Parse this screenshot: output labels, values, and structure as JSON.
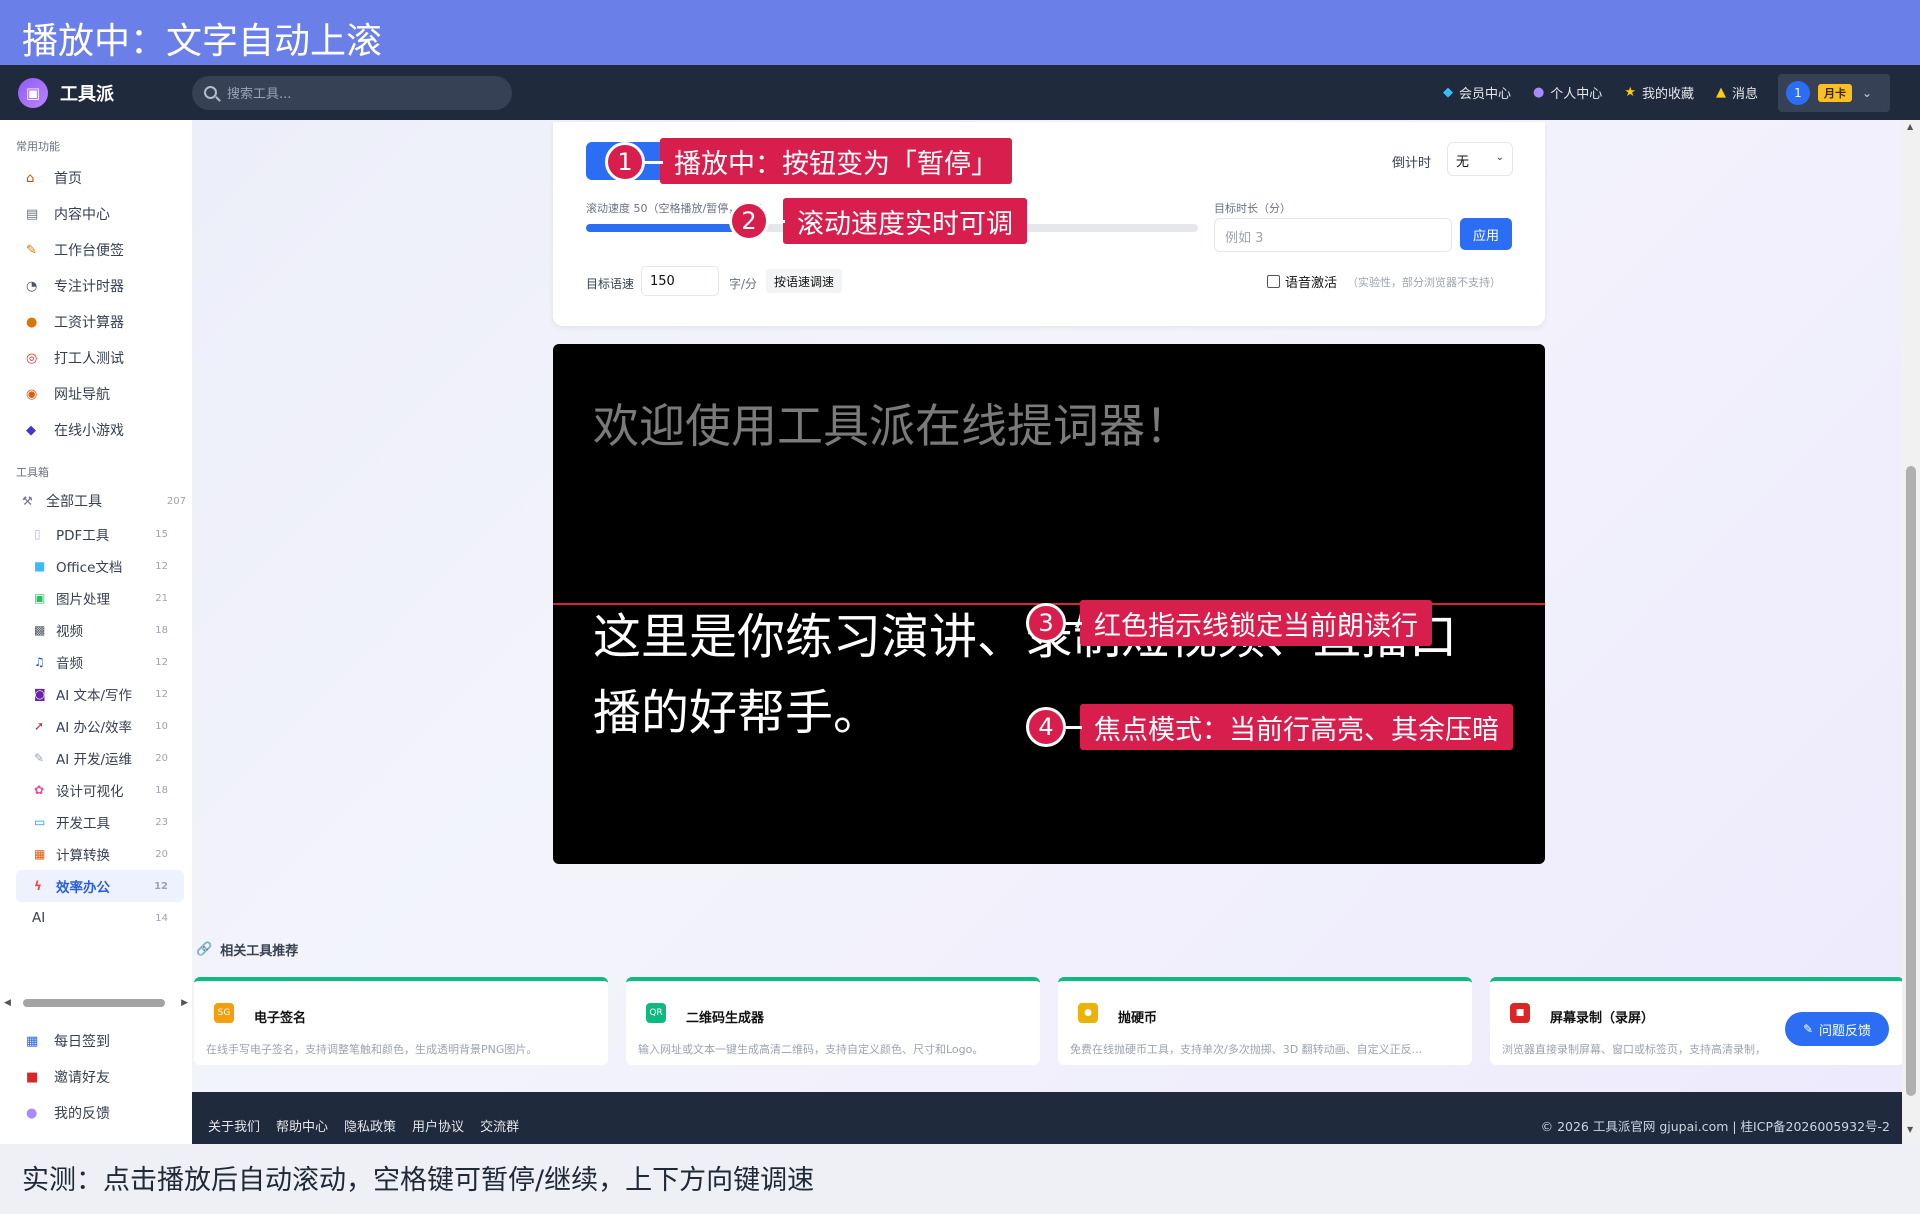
{
  "banner": {
    "title": "播放中：文字自动上滚"
  },
  "header": {
    "logo_text": "工具派",
    "search_placeholder": "搜索工具...",
    "nav": [
      {
        "icon": "diamond-icon",
        "label": "会员中心"
      },
      {
        "icon": "person-icon",
        "label": "个人中心"
      },
      {
        "icon": "star-icon",
        "label": "我的收藏"
      },
      {
        "icon": "bell-icon",
        "label": "消息"
      }
    ],
    "user_avatar": "1",
    "user_badge": "月卡"
  },
  "sidebar": {
    "common_title": "常用功能",
    "common_items": [
      {
        "icon": "home-icon",
        "label": "首页"
      },
      {
        "icon": "news-icon",
        "label": "内容中心"
      },
      {
        "icon": "memo-icon",
        "label": "工作台便签"
      },
      {
        "icon": "stopwatch-icon",
        "label": "专注计时器"
      },
      {
        "icon": "money-bag-icon",
        "label": "工资计算器"
      },
      {
        "icon": "target-icon",
        "label": "打工人测试"
      },
      {
        "icon": "compass-icon",
        "label": "网址导航"
      },
      {
        "icon": "gamepad-icon",
        "label": "在线小游戏"
      }
    ],
    "toolbox_title": "工具箱",
    "all_tools": {
      "label": "全部工具",
      "count": "207"
    },
    "tool_items": [
      {
        "icon": "pdf-icon",
        "label": "PDF工具",
        "count": "15"
      },
      {
        "icon": "office-icon",
        "label": "Office文档",
        "count": "12"
      },
      {
        "icon": "image-icon",
        "label": "图片处理",
        "count": "21"
      },
      {
        "icon": "clapper-icon",
        "label": "视频",
        "count": "18"
      },
      {
        "icon": "music-icon",
        "label": "音频",
        "count": "12"
      },
      {
        "icon": "robot-icon",
        "label": "AI 文本/写作",
        "count": "12"
      },
      {
        "icon": "rocket-icon",
        "label": "AI 办公/效率",
        "count": "10"
      },
      {
        "icon": "wrench-icon",
        "label": "AI 开发/运维",
        "count": "20"
      },
      {
        "icon": "palette-icon",
        "label": "设计可视化",
        "count": "18"
      },
      {
        "icon": "laptop-icon",
        "label": "开发工具",
        "count": "23"
      },
      {
        "icon": "calculator-icon",
        "label": "计算转换",
        "count": "20"
      },
      {
        "icon": "lightning-icon",
        "label": "效率办公",
        "count": "12"
      },
      {
        "icon": "",
        "label": "AI",
        "count": "14"
      }
    ],
    "bottom_items": [
      {
        "icon": "calendar-icon",
        "label": "每日签到"
      },
      {
        "icon": "gift-icon",
        "label": "邀请好友"
      },
      {
        "icon": "speech-icon",
        "label": "我的反馈"
      }
    ]
  },
  "controls": {
    "countdown_label": "倒计时",
    "countdown_value": "无",
    "speed_label": "滚动速度 50（空格播放/暂停，调速",
    "speed_value": 50,
    "speed_fill_fraction": 0.25,
    "duration_label": "目标时长（分）",
    "duration_placeholder": "例如 3",
    "apply_label": "应用",
    "wpm_label": "目标语速",
    "wpm_value": "150",
    "wpm_unit": "字/分",
    "wpm_button": "按语速调速",
    "voice_label": "语音激活",
    "voice_note": "（实验性，部分浏览器不支持）"
  },
  "prompter": {
    "line1": "欢迎使用工具派在线提词器！",
    "line2": "这里是你练习演讲、录制短视频、直播口播的好帮手。"
  },
  "related": {
    "title": "相关工具推荐",
    "cards": [
      {
        "icon_text": "SG",
        "icon_color": "#f59e0b",
        "title": "电子签名",
        "desc": "在线手写电子签名，支持调整笔触和颜色，生成透明背景PNG图片。"
      },
      {
        "icon_text": "QR",
        "icon_color": "#10b981",
        "title": "二维码生成器",
        "desc": "输入网址或文本一键生成高清二维码，支持自定义颜色、尺寸和Logo。"
      },
      {
        "icon_text": "●",
        "icon_color": "#eab308",
        "title": "抛硬币",
        "desc": "免费在线抛硬币工具，支持单次/多次抛掷、3D 翻转动画、自定义正反..."
      },
      {
        "icon_text": "■",
        "icon_color": "#dc2626",
        "title": "屏幕录制（录屏）",
        "desc": "浏览器直接录制屏幕、窗口或标签页，支持高清录制，"
      }
    ]
  },
  "feedback_button": "问题反馈",
  "footer": {
    "links": [
      "关于我们",
      "帮助中心",
      "隐私政策",
      "用户协议",
      "交流群"
    ],
    "copyright": "© 2026 工具派官网 gjupai.com | 桂ICP备2026005932号-2"
  },
  "annotations": [
    {
      "num": "1",
      "text": "播放中：按钮变为「暂停」"
    },
    {
      "num": "2",
      "text": "滚动速度实时可调"
    },
    {
      "num": "3",
      "text": "红色指示线锁定当前朗读行"
    },
    {
      "num": "4",
      "text": "焦点模式：当前行高亮、其余压暗"
    }
  ],
  "bottom_caption": "实测：点击播放后自动滚动，空格键可暂停/继续，上下方向键调速"
}
